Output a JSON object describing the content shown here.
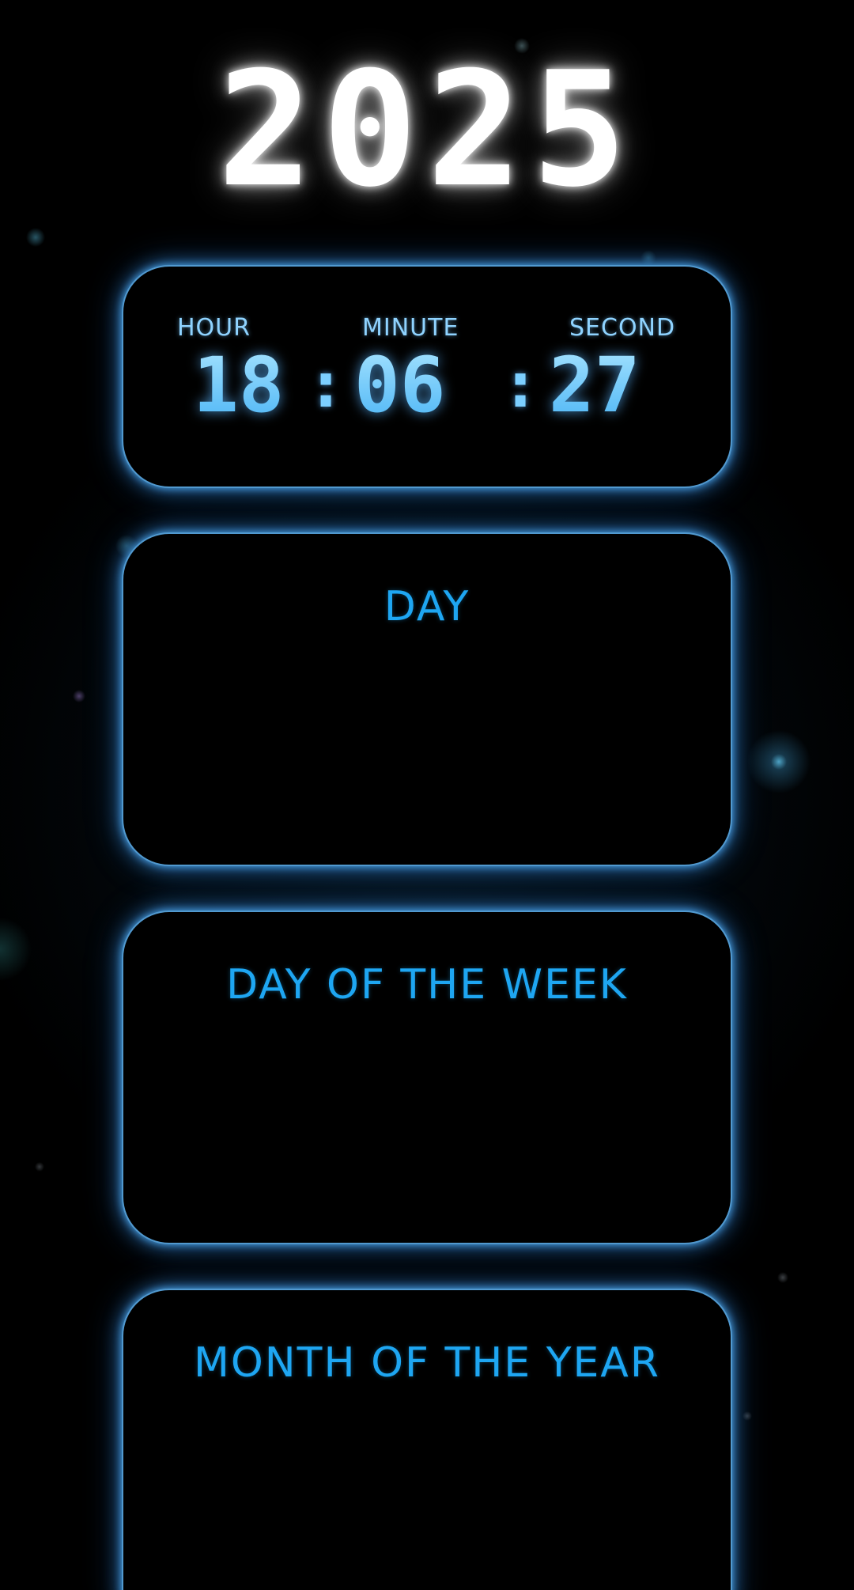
{
  "year": "2025",
  "clock": {
    "hour_label": "HOUR",
    "minute_label": "MINUTE",
    "second_label": "SECOND",
    "hour": "18",
    "minute": "06",
    "second": "27",
    "separator": ":"
  },
  "panels": {
    "day_title": "DAY",
    "day_of_week_title": "DAY OF THE WEEK",
    "month_title": "MONTH OF THE YEAR"
  },
  "colors": {
    "background": "#000000",
    "year_text": "#ffffff",
    "accent": "#1ea6f2",
    "clock_digits": "#6cc8ff",
    "panel_glow": "#5aaae6"
  }
}
